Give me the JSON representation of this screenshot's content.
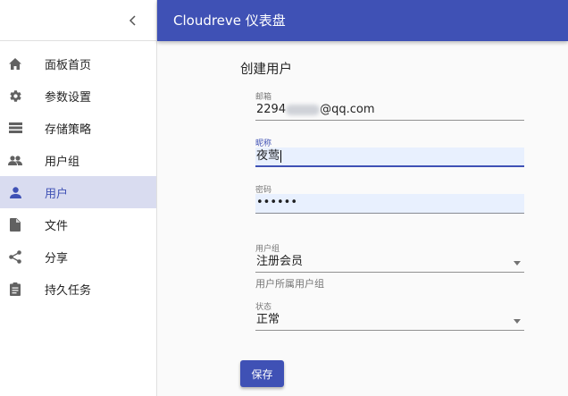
{
  "app": {
    "title": "Cloudreve 仪表盘"
  },
  "sidebar": {
    "items": [
      {
        "label": "面板首页",
        "icon": "home-icon"
      },
      {
        "label": "参数设置",
        "icon": "gear-icon"
      },
      {
        "label": "存储策略",
        "icon": "storage-icon"
      },
      {
        "label": "用户组",
        "icon": "group-icon"
      },
      {
        "label": "用户",
        "icon": "person-icon",
        "active": true
      },
      {
        "label": "文件",
        "icon": "file-icon"
      },
      {
        "label": "分享",
        "icon": "share-icon"
      },
      {
        "label": "持久任务",
        "icon": "task-icon"
      }
    ]
  },
  "form": {
    "title": "创建用户",
    "email": {
      "label": "邮箱",
      "value_prefix": "2294",
      "value_suffix": "@qq.com"
    },
    "nickname": {
      "label": "昵称",
      "value": "夜莺"
    },
    "password": {
      "label": "密码",
      "value": "••••••"
    },
    "group": {
      "label": "用户组",
      "value": "注册会员",
      "helper": "用户所属用户组"
    },
    "status": {
      "label": "状态",
      "value": "正常"
    },
    "save_label": "保存"
  },
  "colors": {
    "primary": "#3f51b5",
    "active_bg": "#d9dcf0",
    "autofill_bg": "#e8f0fe"
  }
}
